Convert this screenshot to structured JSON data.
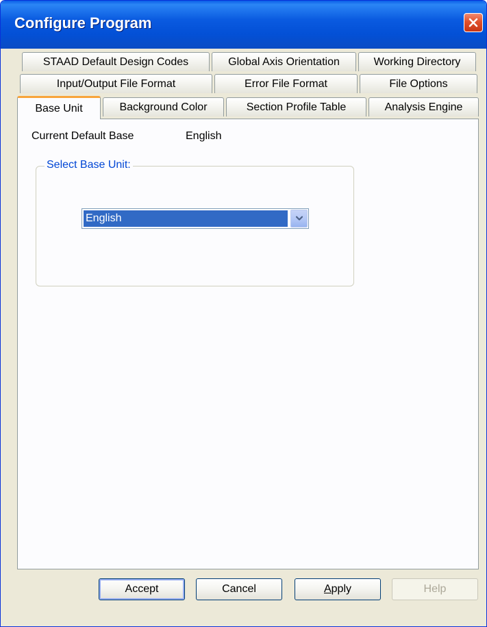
{
  "window": {
    "title": "Configure Program"
  },
  "tabs": {
    "row1": [
      "STAAD Default Design Codes",
      "Global Axis Orientation",
      "Working Directory"
    ],
    "row2": [
      "Input/Output File Format",
      "Error File Format",
      "File Options"
    ],
    "row3": [
      "Base Unit",
      "Background Color",
      "Section Profile Table",
      "Analysis Engine"
    ],
    "active": "Base Unit"
  },
  "base_unit": {
    "current_label": "Current Default Base",
    "current_value": "English",
    "group_label": "Select Base Unit:",
    "selected": "English"
  },
  "buttons": {
    "accept": "Accept",
    "cancel": "Cancel",
    "apply_mnemonic": "A",
    "apply_rest": "pply",
    "help": "Help"
  },
  "colors": {
    "titlebar": "#0a5ae0",
    "active_tab_accent": "#f8a43a",
    "selection": "#316ac5",
    "group_label": "#0046d5"
  }
}
